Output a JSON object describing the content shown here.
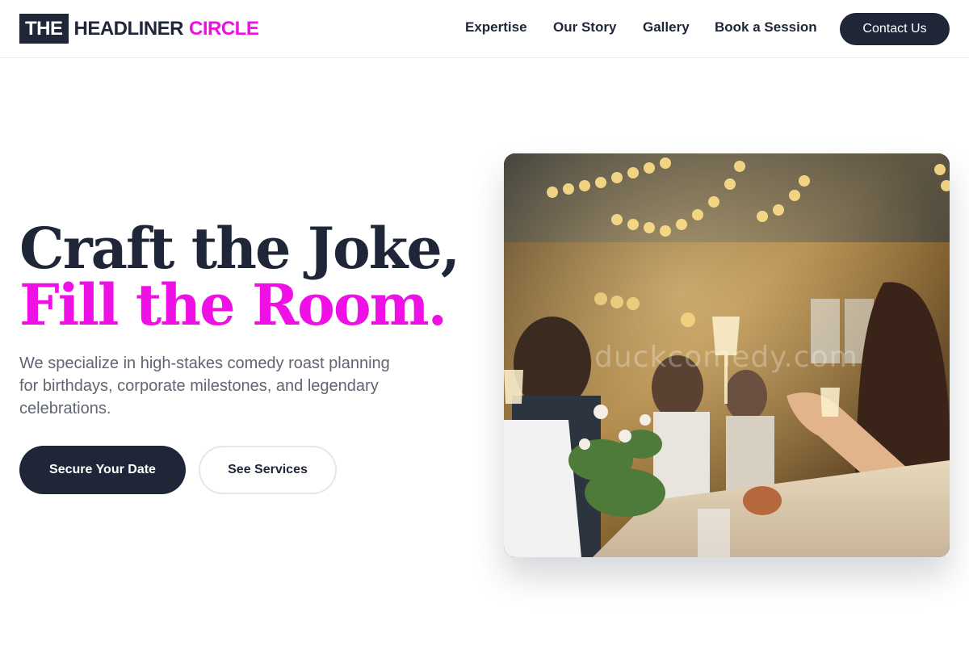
{
  "brand": {
    "part1": "THE",
    "part2": "HEADLINER",
    "part3": "CIRCLE"
  },
  "nav": {
    "items": [
      {
        "label": "Expertise"
      },
      {
        "label": "Our Story"
      },
      {
        "label": "Gallery"
      },
      {
        "label": "Book a Session"
      }
    ],
    "contact_label": "Contact Us"
  },
  "hero": {
    "headline_line1": "Craft the Joke,",
    "headline_line2": "Fill the Room.",
    "subtitle": "We specialize in high-stakes comedy roast planning for birthdays, corporate milestones, and legendary celebrations.",
    "primary_cta": "Secure Your Date",
    "secondary_cta": "See Services"
  },
  "image": {
    "subject": "guests raising champagne glasses at a banquet table",
    "watermark": "duckcomedy.com"
  },
  "colors": {
    "navy": "#1e2638",
    "accent": "#ee10e4",
    "muted_text": "#5f6572"
  }
}
